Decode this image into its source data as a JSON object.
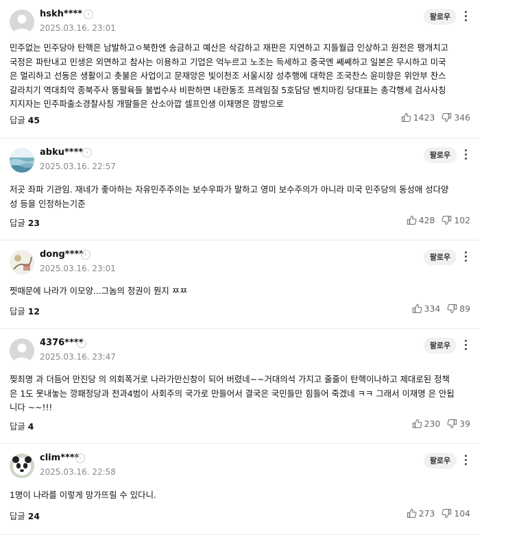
{
  "comments": [
    {
      "nickname": "hskh****",
      "date": "2025.03.16. 23:01",
      "follow_label": "팔로우",
      "text": "민주없는 민주당아 탄핵은 남발하고ㅇ북한엔 송금하고 예산은 삭감하고 재판은 지연하고 지들월급 인상하고 원전은 팽개치고\n국정은 파탄내고 민생은 외면하고 참사는 이용하고 기업은 억누르고 노조는 득세하고 중국엔 쎼쎼하고 일본은 무시하고 미국\n은 멀리하고 선동은 생활이고 촛불은 사업이고 문재앙은 빛이천조 서울시장 성추행에 대학은 조국찬스 윤미향은 위안부 찬스\n갈라치기 역대최악 종북주사 똥팔육들 불법수사 비판하면 내란동조 프레임질 5호담당 벤치마킹 당대표는 총각행세 검사사칭\n지지자는 민주파출소경찰사칭 개딸들은 산소아깝 셀프인생 이재명은 깜방으로",
      "reply_label": "답글",
      "reply_count": "45",
      "likes": "1423",
      "dislikes": "346",
      "avatar": "default"
    },
    {
      "nickname": "abku****",
      "date": "2025.03.16. 22:57",
      "follow_label": "팔로우",
      "text": "저곳 좌파 기관임. 재네가 좋아하는 자유민주주의는 보수우파가 말하고 영미 보수주의가 아니라 미국 민주당의 동성애 성다양\n성 등을 인정하는기준",
      "reply_label": "답글",
      "reply_count": "23",
      "likes": "428",
      "dislikes": "102",
      "avatar": "sea"
    },
    {
      "nickname": "dong****",
      "date": "2025.03.16. 23:01",
      "follow_label": "팔로우",
      "text": "찟때문에 나라가 이모양...그놈의 정권이 뭔지 ㅉㅉ",
      "reply_label": "답글",
      "reply_count": "12",
      "likes": "334",
      "dislikes": "89",
      "avatar": "art"
    },
    {
      "nickname": "4376****",
      "date": "2025.03.16. 23:47",
      "follow_label": "팔로우",
      "text": "찢죄명 과 더듬어 만진당 의 의회폭거로 나라가만신창이 되어 버렸네~~거대의석 가지고 줄줄이 탄핵이나하고 제대로된 정책\n은 1도 못내놓는 깡패정당과 전과4범이 사회주의 국가로 만들어서 결국은 국민들만 힘들어 죽겠네 ㅋㅋ 그래서 이재명 은 안됩\n니다 ~~!!!",
      "reply_label": "답글",
      "reply_count": "4",
      "likes": "230",
      "dislikes": "39",
      "avatar": "default"
    },
    {
      "nickname": "clim****",
      "date": "2025.03.16. 22:58",
      "follow_label": "팔로우",
      "text": "1명이 나라를 이렇게 망가뜨릴 수 있다니.",
      "reply_label": "답글",
      "reply_count": "24",
      "likes": "273",
      "dislikes": "104",
      "avatar": "panda"
    }
  ]
}
